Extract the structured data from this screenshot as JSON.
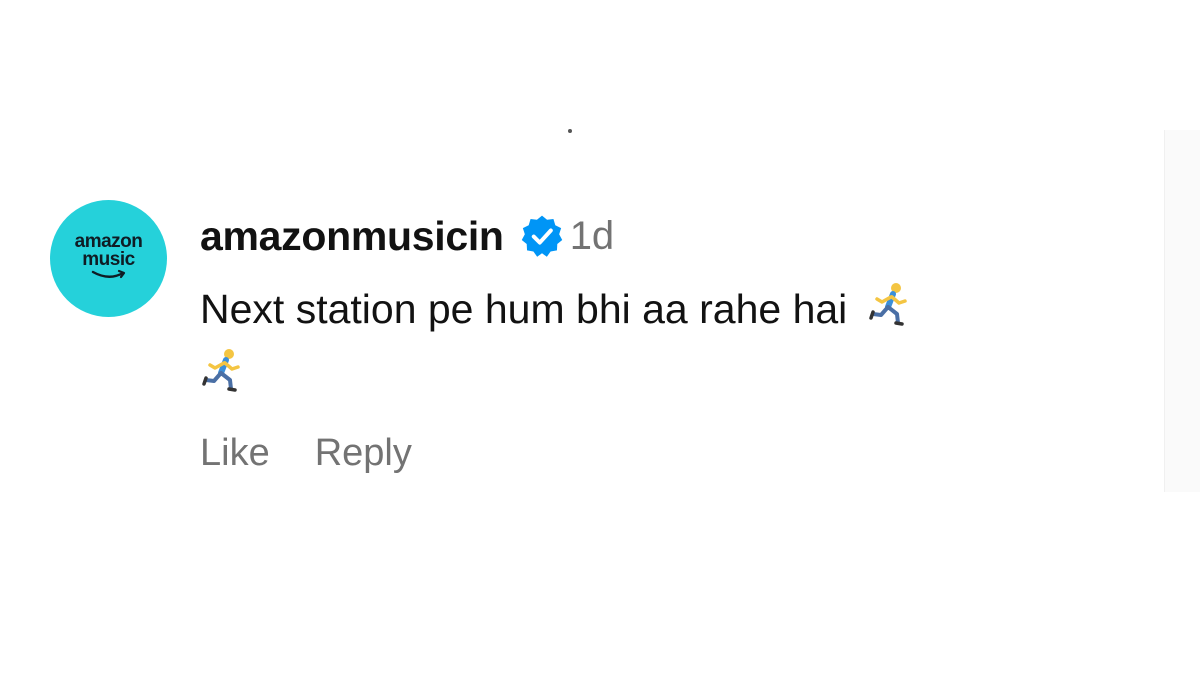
{
  "comment": {
    "avatar": {
      "line1": "amazon",
      "line2": "music",
      "color": "#25d1da"
    },
    "username": "amazonmusicin",
    "verified_icon": "verified-badge-icon",
    "time": "1d",
    "text": "Next station pe hum bhi aa rahe hai",
    "emoji_icons": [
      "person-running-icon",
      "person-running-icon"
    ],
    "actions": {
      "like": "Like",
      "reply": "Reply"
    }
  },
  "colors": {
    "accent": "#0095f6",
    "text": "#121212",
    "muted": "#737373"
  }
}
